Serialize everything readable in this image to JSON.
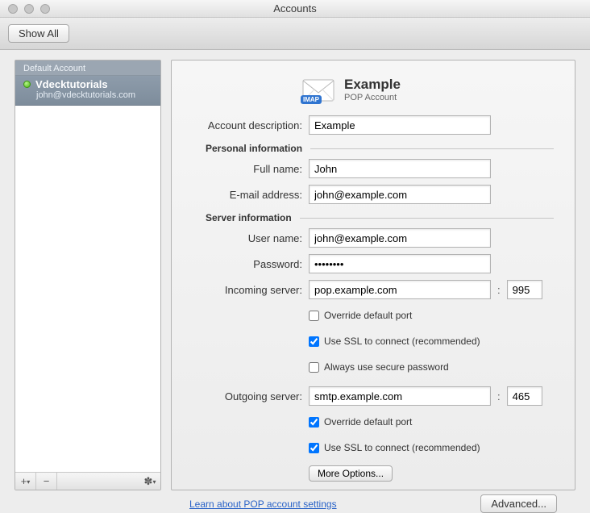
{
  "window": {
    "title": "Accounts"
  },
  "toolbar": {
    "show_all": "Show All"
  },
  "sidebar": {
    "section_title": "Default Account",
    "account": {
      "name": "Vdecktutorials",
      "email": "john@vdecktutorials.com"
    }
  },
  "header": {
    "title": "Example",
    "subtitle": "POP Account",
    "imap_badge": "IMAP"
  },
  "labels": {
    "account_description": "Account description:",
    "personal_info": "Personal information",
    "full_name": "Full name:",
    "email": "E-mail address:",
    "server_info": "Server information",
    "user_name": "User name:",
    "password": "Password:",
    "incoming": "Incoming server:",
    "outgoing": "Outgoing server:",
    "override_port": "Override default port",
    "use_ssl": "Use SSL to connect (recommended)",
    "secure_pw": "Always use secure password",
    "more_options": "More Options...",
    "learn": "Learn about POP account settings",
    "advanced": "Advanced..."
  },
  "values": {
    "account_description": "Example",
    "full_name": "John",
    "email": "john@example.com",
    "user_name": "john@example.com",
    "password": "••••••••",
    "incoming_server": "pop.example.com",
    "incoming_port": "995",
    "in_override": false,
    "in_ssl": true,
    "in_secure_pw": false,
    "outgoing_server": "smtp.example.com",
    "outgoing_port": "465",
    "out_override": true,
    "out_ssl": true
  }
}
